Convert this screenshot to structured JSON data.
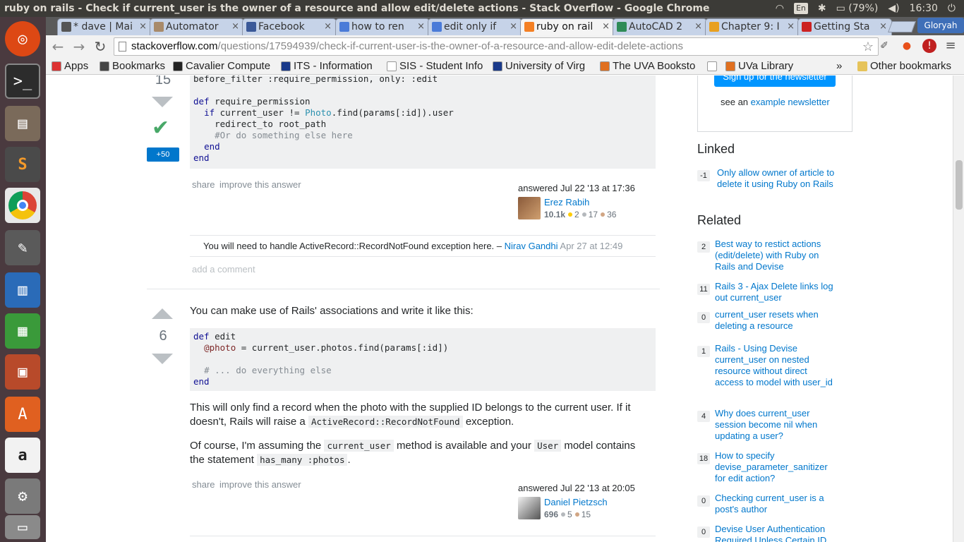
{
  "os": {
    "window_title": "ruby on rails - Check if current_user is the owner of a resource and allow edit/delete actions - Stack Overflow - Google Chrome",
    "lang": "En",
    "battery": "(79%)",
    "clock": "16:30"
  },
  "launcher": [
    "ubuntu-dash",
    "terminal",
    "files",
    "sublime-text",
    "chrome",
    "text-editor",
    "libreoffice-writer",
    "libreoffice-calc",
    "libreoffice-impress",
    "software-center",
    "amazon",
    "system-settings",
    "trash"
  ],
  "tabs": [
    {
      "label": "* dave | Mai",
      "color": "#555555"
    },
    {
      "label": "Automator",
      "color": "#a88a6a"
    },
    {
      "label": "Facebook",
      "color": "#3b5998"
    },
    {
      "label": "how to ren",
      "color": "#4a7bd8"
    },
    {
      "label": "edit only if",
      "color": "#4a7bd8"
    },
    {
      "label": "ruby on rail",
      "color": "#f48024"
    },
    {
      "label": "AutoCAD 2",
      "color": "#2e8b57"
    },
    {
      "label": "Chapter 9: I",
      "color": "#e8a020"
    },
    {
      "label": "Getting Sta",
      "color": "#cc2222"
    }
  ],
  "profile_name": "Gloryah",
  "omnibox": {
    "host": "stackoverflow.com",
    "path": "/questions/17594939/check-if-current-user-is-the-owner-of-a-resource-and-allow-edit-delete-actions"
  },
  "bookmarks": [
    {
      "label": "Apps",
      "color": "#d33"
    },
    {
      "label": "Bookmarks",
      "color": "#444"
    },
    {
      "label": "Cavalier Compute",
      "color": "#222"
    },
    {
      "label": "ITS - Information",
      "color": "#1a3a8a"
    },
    {
      "label": "SIS - Student Info",
      "color": "#fff"
    },
    {
      "label": "University of Virg",
      "color": "#1a3a8a"
    },
    {
      "label": "The UVA Booksto",
      "color": "#e07020"
    },
    {
      "label": "",
      "color": "#fff"
    },
    {
      "label": "UVa Library",
      "color": "#e07020"
    }
  ],
  "bookmarks_overflow": "»",
  "other_bookmarks": "Other bookmarks",
  "answer1": {
    "vote_count": "15",
    "bounty": "+50",
    "code_line1": "before_filter :require_permission, only: :edit",
    "share": "share",
    "improve": "improve this answer",
    "answered": "answered Jul 22 '13 at 17:36",
    "user": "Erez Rabih",
    "rep": "10.1k",
    "gold": "2",
    "silver": "17",
    "bronze": "36",
    "comment_text": "You will need to handle ActiveRecord::RecordNotFound exception here. –",
    "comment_user": "Nirav Gandhi",
    "comment_date": "Apr 27 at 12:49",
    "add_comment": "add a comment"
  },
  "answer2": {
    "vote_count": "6",
    "intro": "You can make use of Rails' associations and write it like this:",
    "para1_a": "This will only find a record when the photo with the supplied ID belongs to the current user. If it doesn't, Rails will raise a",
    "para1_code": "ActiveRecord::RecordNotFound",
    "para1_b": "exception.",
    "para2_a": "Of course, I'm assuming the",
    "para2_code1": "current_user",
    "para2_b": "method is available and your",
    "para2_code2": "User",
    "para2_c": "model contains the statement",
    "para2_code3": "has_many :photos",
    "para2_d": ".",
    "share": "share",
    "improve": "improve this answer",
    "answered": "answered Jul 22 '13 at 20:05",
    "user": "Daniel Pietzsch",
    "rep": "696",
    "silver": "5",
    "bronze": "15"
  },
  "sidebar": {
    "newsletter_button": "Sign up for the newsletter",
    "newsletter_see": "see an",
    "newsletter_link": "example newsletter",
    "linked_title": "Linked",
    "linked": [
      {
        "count": "-1",
        "title": "Only allow owner of article to delete it using Ruby on Rails"
      }
    ],
    "related_title": "Related",
    "related": [
      {
        "count": "2",
        "title": "Best way to restict actions (edit/delete) with Ruby on Rails and Devise"
      },
      {
        "count": "11",
        "title": "Rails 3 - Ajax Delete links log out current_user"
      },
      {
        "count": "0",
        "title": "current_user resets when deleting a resource"
      },
      {
        "count": "1",
        "title": "Rails - Using Devise current_user on nested resource without direct access to model with user_id"
      },
      {
        "count": "4",
        "title": "Why does current_user session become nil when updating a user?"
      },
      {
        "count": "18",
        "title": "How to specify devise_parameter_sanitizer for edit action?"
      },
      {
        "count": "0",
        "title": "Checking current_user is a post's author"
      },
      {
        "count": "0",
        "title": "Devise User Authentication Required Unless Certain ID"
      }
    ]
  }
}
